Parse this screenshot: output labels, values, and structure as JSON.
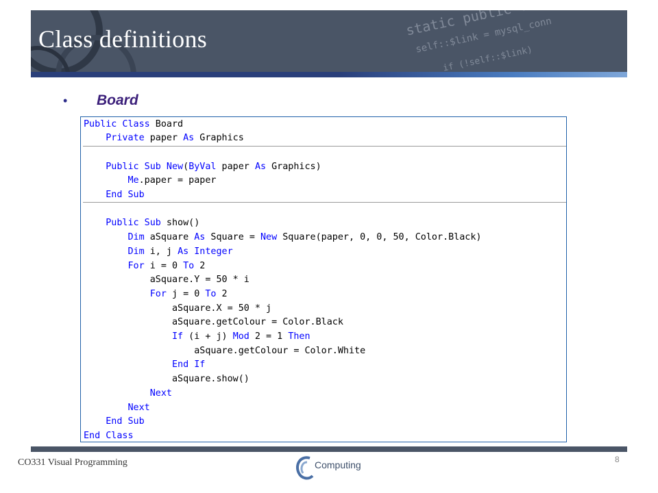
{
  "slide": {
    "title": "Class definitions",
    "bullet": "Board",
    "footer": "CO331 Visual Programming",
    "logo_text": "Computing",
    "page_number": "8"
  },
  "code": [
    [
      {
        "t": "Public Class",
        "k": true
      },
      {
        "t": " Board",
        "k": false
      }
    ],
    [
      {
        "t": "    ",
        "k": false
      },
      {
        "t": "Private",
        "k": true
      },
      {
        "t": " paper ",
        "k": false
      },
      {
        "t": "As",
        "k": true
      },
      {
        "t": " Graphics",
        "k": false
      }
    ],
    [],
    [
      {
        "t": "    ",
        "k": false
      },
      {
        "t": "Public Sub New",
        "k": true
      },
      {
        "t": "(",
        "k": false
      },
      {
        "t": "ByVal",
        "k": true
      },
      {
        "t": " paper ",
        "k": false
      },
      {
        "t": "As",
        "k": true
      },
      {
        "t": " Graphics)",
        "k": false
      }
    ],
    [
      {
        "t": "        ",
        "k": false
      },
      {
        "t": "Me",
        "k": true
      },
      {
        "t": ".paper = paper",
        "k": false
      }
    ],
    [
      {
        "t": "    ",
        "k": false
      },
      {
        "t": "End Sub",
        "k": true
      }
    ],
    [],
    [
      {
        "t": "    ",
        "k": false
      },
      {
        "t": "Public Sub",
        "k": true
      },
      {
        "t": " show()",
        "k": false
      }
    ],
    [
      {
        "t": "        ",
        "k": false
      },
      {
        "t": "Dim",
        "k": true
      },
      {
        "t": " aSquare ",
        "k": false
      },
      {
        "t": "As",
        "k": true
      },
      {
        "t": " Square = ",
        "k": false
      },
      {
        "t": "New",
        "k": true
      },
      {
        "t": " Square(paper, 0, 0, 50, Color.Black)",
        "k": false
      }
    ],
    [
      {
        "t": "        ",
        "k": false
      },
      {
        "t": "Dim",
        "k": true
      },
      {
        "t": " i, j ",
        "k": false
      },
      {
        "t": "As Integer",
        "k": true
      }
    ],
    [
      {
        "t": "        ",
        "k": false
      },
      {
        "t": "For",
        "k": true
      },
      {
        "t": " i = 0 ",
        "k": false
      },
      {
        "t": "To",
        "k": true
      },
      {
        "t": " 2",
        "k": false
      }
    ],
    [
      {
        "t": "            aSquare.Y = 50 * i",
        "k": false
      }
    ],
    [
      {
        "t": "            ",
        "k": false
      },
      {
        "t": "For",
        "k": true
      },
      {
        "t": " j = 0 ",
        "k": false
      },
      {
        "t": "To",
        "k": true
      },
      {
        "t": " 2",
        "k": false
      }
    ],
    [
      {
        "t": "                aSquare.X = 50 * j",
        "k": false
      }
    ],
    [
      {
        "t": "                aSquare.getColour = Color.Black",
        "k": false
      }
    ],
    [
      {
        "t": "                ",
        "k": false
      },
      {
        "t": "If",
        "k": true
      },
      {
        "t": " (i + j) ",
        "k": false
      },
      {
        "t": "Mod",
        "k": true
      },
      {
        "t": " 2 = 1 ",
        "k": false
      },
      {
        "t": "Then",
        "k": true
      }
    ],
    [
      {
        "t": "                    aSquare.getColour = Color.White",
        "k": false
      }
    ],
    [
      {
        "t": "                ",
        "k": false
      },
      {
        "t": "End If",
        "k": true
      }
    ],
    [
      {
        "t": "                aSquare.show()",
        "k": false
      }
    ],
    [
      {
        "t": "            ",
        "k": false
      },
      {
        "t": "Next",
        "k": true
      }
    ],
    [
      {
        "t": "        ",
        "k": false
      },
      {
        "t": "Next",
        "k": true
      }
    ],
    [
      {
        "t": "    ",
        "k": false
      },
      {
        "t": "End Sub",
        "k": true
      }
    ],
    [
      {
        "t": "End Class",
        "k": true
      }
    ]
  ],
  "colors": {
    "keyword": "#0000ff",
    "text": "#000000",
    "header_bg": "#4a5566",
    "accent_bar": "#2a3f7a",
    "bullet_text": "#3b1f7a",
    "code_border": "#1e5fa8"
  }
}
